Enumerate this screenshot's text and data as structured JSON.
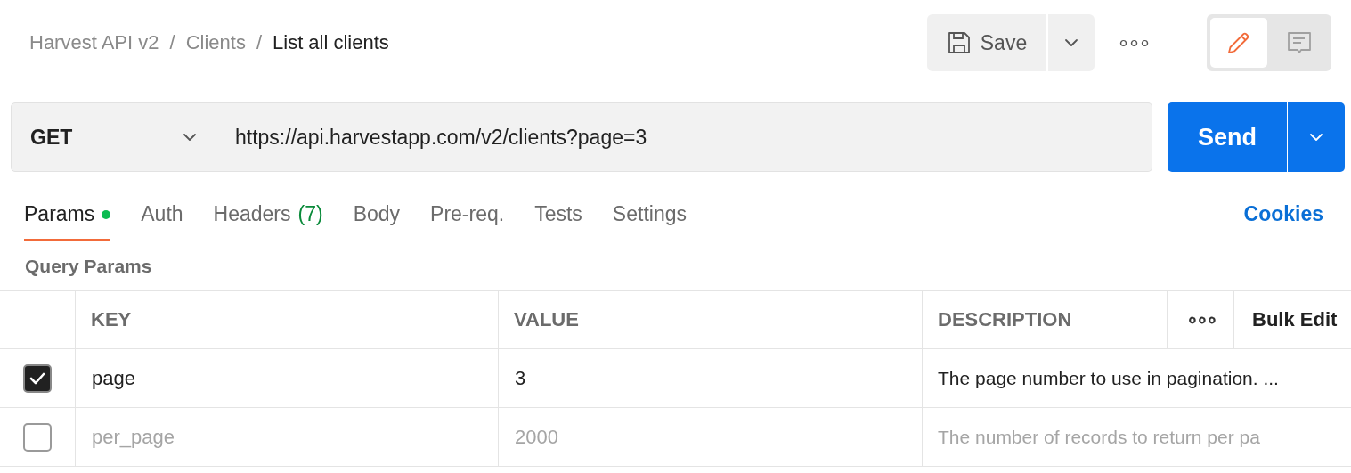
{
  "breadcrumb": [
    {
      "label": "Harvest API v2",
      "current": false
    },
    {
      "label": "Clients",
      "current": false
    },
    {
      "label": "List all clients",
      "current": true
    }
  ],
  "breadcrumb_separator": "/",
  "save_button": {
    "label": "Save"
  },
  "more_button": "∘∘∘",
  "view_toggle": [
    {
      "kind": "edit",
      "selected": true
    },
    {
      "kind": "comments",
      "selected": false
    }
  ],
  "request": {
    "method": "GET",
    "url": "https://api.harvestapp.com/v2/clients?page=3"
  },
  "send_button": {
    "label": "Send"
  },
  "tabs": [
    {
      "label": "Params",
      "selected": true,
      "modified": true
    },
    {
      "label": "Auth",
      "selected": false,
      "modified": false
    },
    {
      "label": "Headers",
      "count": "(7)",
      "selected": false,
      "modified": false
    },
    {
      "label": "Body",
      "selected": false,
      "modified": false
    },
    {
      "label": "Pre-req.",
      "selected": false,
      "modified": false
    },
    {
      "label": "Tests",
      "selected": false,
      "modified": false
    },
    {
      "label": "Settings",
      "selected": false,
      "modified": false
    }
  ],
  "cookies_link": "Cookies",
  "section_title": "Query Params",
  "table": {
    "columns": [
      "KEY",
      "VALUE",
      "DESCRIPTION"
    ],
    "more_button": "∘∘∘",
    "bulk_edit": "Bulk Edit",
    "rows": [
      {
        "checked": true,
        "key": "page",
        "value": "3",
        "description": "The page number to use in pagination. ..."
      },
      {
        "checked": false,
        "key": "per_page",
        "value": "2000",
        "description": "The number of records to return per pa"
      }
    ]
  }
}
